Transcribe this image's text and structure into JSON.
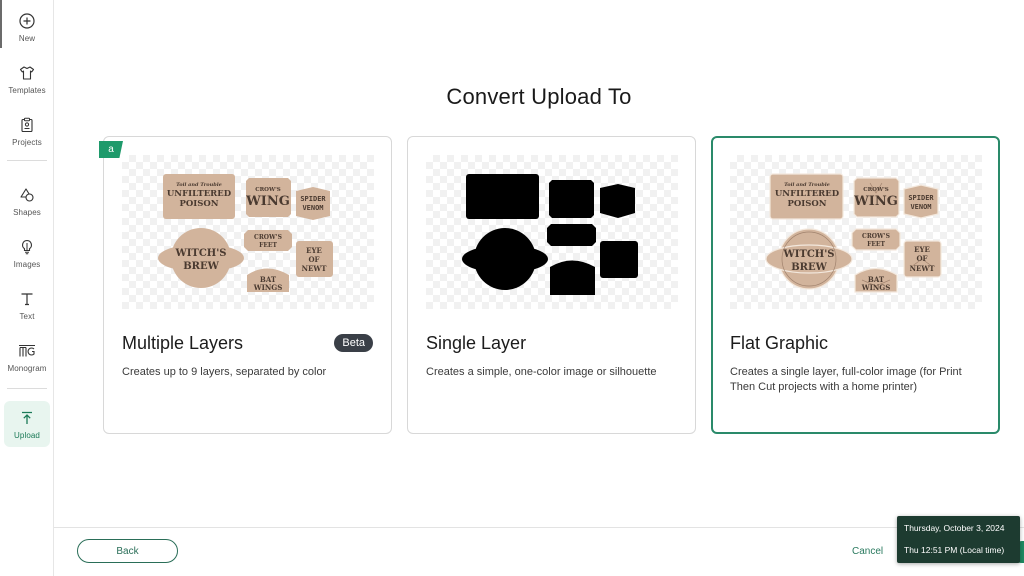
{
  "sidebar": {
    "items": [
      {
        "label": "New",
        "icon": "plus-circle-icon"
      },
      {
        "label": "Templates",
        "icon": "tshirt-icon"
      },
      {
        "label": "Projects",
        "icon": "clipboard-icon"
      },
      {
        "label": "Shapes",
        "icon": "shapes-icon"
      },
      {
        "label": "Images",
        "icon": "lightbulb-icon"
      },
      {
        "label": "Text",
        "icon": "text-icon"
      },
      {
        "label": "Monogram",
        "icon": "monogram-icon"
      },
      {
        "label": "Upload",
        "icon": "upload-icon",
        "active": true
      }
    ]
  },
  "page": {
    "title": "Convert Upload To"
  },
  "options": [
    {
      "title": "Multiple Layers",
      "description": "Creates up to 9 layers, separated by color",
      "badge": "Beta",
      "corner_tag": "a",
      "preview": "color-labels",
      "selected": false
    },
    {
      "title": "Single Layer",
      "description": "Creates a simple, one-color image or silhouette",
      "preview": "silhouette",
      "selected": false
    },
    {
      "title": "Flat Graphic",
      "description": "Creates a single layer, full-color image (for Print Then Cut projects with a home printer)",
      "preview": "full-color-labels",
      "selected": true
    }
  ],
  "preview_labels": {
    "poison_top": "Toil and Trouble",
    "poison_main1": "UNFILTERED",
    "poison_main2": "POISON",
    "wing_top": "CROW'S",
    "wing_main": "WING",
    "spider1": "SPIDER",
    "spider2": "VENOM",
    "crows1": "CROW'S",
    "crows2": "FEET",
    "witch1": "WITCH'S",
    "witch2": "BREW",
    "eye1": "EYE",
    "eye2": "OF",
    "eye3": "NEWT",
    "bat1": "BAT",
    "bat2": "WINGS"
  },
  "colors": {
    "accent": "#1e8a62",
    "selected_border": "#2a8a6a",
    "label_fill": "#d2b49c",
    "label_text": "#4a3a30",
    "tooltip_bg": "#1d3b30",
    "badge_bg": "#3a3f47"
  },
  "footer": {
    "back_label": "Back",
    "cancel_label": "Cancel"
  },
  "tooltip": {
    "date": "Thursday, October 3, 2024",
    "time": "Thu 12:51 PM (Local time)"
  }
}
